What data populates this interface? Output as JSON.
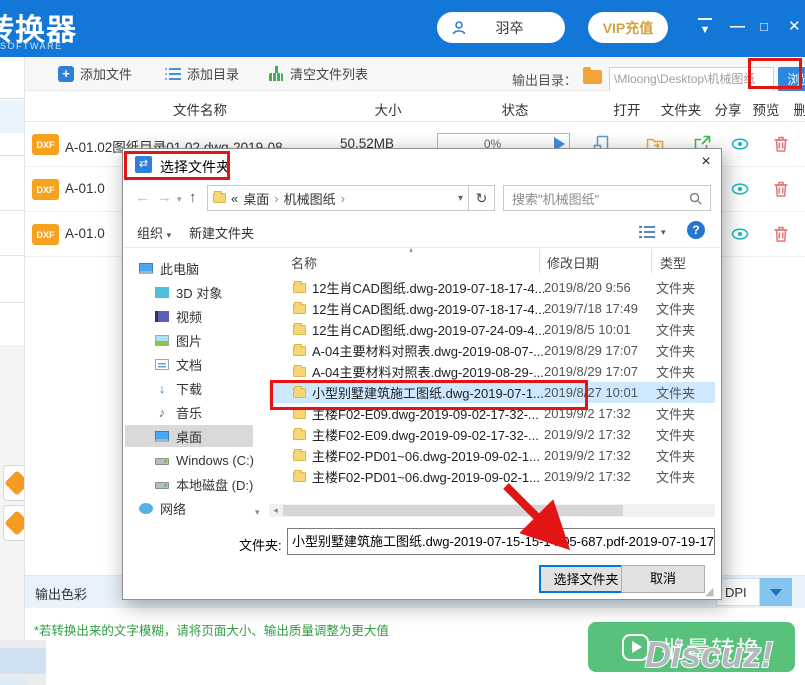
{
  "header": {
    "app_title": "转换器",
    "app_subtitle": "N SOFTWARE",
    "username": "羽卒",
    "vip_label": "VIP充值"
  },
  "toolbar": {
    "add_file": "添加文件",
    "add_folder": "添加目录",
    "clear_list": "清空文件列表",
    "output_dir_label": "输出目录：",
    "output_dir_value": "\\Mloong\\Desktop\\机械图纸",
    "browse": "浏览"
  },
  "table": {
    "cols": {
      "name": "文件名称",
      "size": "大小",
      "status": "状态",
      "open": "打开",
      "folder": "文件夹",
      "share": "分享",
      "preview": "预览",
      "del": "删除"
    },
    "rows": [
      {
        "badge": "DXF",
        "name": "A-01.02图纸目录01.02.dwg-2019-08-",
        "size": "50.52MB",
        "progress": "0%"
      },
      {
        "badge": "DXF",
        "name": "A-01.0"
      },
      {
        "badge": "DXF",
        "name": "A-01.0"
      }
    ]
  },
  "dialog": {
    "title": "选择文件夹",
    "breadcrumb": {
      "collapsed": "«",
      "sep": "›",
      "crumb1": "桌面",
      "crumb2": "机械图纸"
    },
    "search_text": "搜索\"机械图纸\"",
    "menubar": {
      "organize": "组织",
      "new_folder": "新建文件夹"
    },
    "sidebar": [
      {
        "label": "此电脑"
      },
      {
        "label": "3D 对象"
      },
      {
        "label": "视频"
      },
      {
        "label": "图片"
      },
      {
        "label": "文档"
      },
      {
        "label": "下载"
      },
      {
        "label": "音乐"
      },
      {
        "label": "桌面",
        "selected": true
      },
      {
        "label": "Windows (C:)"
      },
      {
        "label": "本地磁盘 (D:)"
      },
      {
        "label": "网络"
      }
    ],
    "list": {
      "col_name": "名称",
      "col_date": "修改日期",
      "col_type": "类型",
      "rows": [
        {
          "name": "12生肖CAD图纸.dwg-2019-07-18-17-4...",
          "date": "2019/8/20 9:56",
          "type": "文件夹"
        },
        {
          "name": "12生肖CAD图纸.dwg-2019-07-18-17-4...",
          "date": "2019/7/18 17:49",
          "type": "文件夹"
        },
        {
          "name": "12生肖CAD图纸.dwg-2019-07-24-09-4...",
          "date": "2019/8/5 10:01",
          "type": "文件夹"
        },
        {
          "name": "A-04主要材料对照表.dwg-2019-08-07-...",
          "date": "2019/8/29 17:07",
          "type": "文件夹"
        },
        {
          "name": "A-04主要材料对照表.dwg-2019-08-29-...",
          "date": "2019/8/29 17:07",
          "type": "文件夹"
        },
        {
          "name": "小型别墅建筑施工图纸.dwg-2019-07-1...",
          "date": "2019/8/27 10:01",
          "type": "文件夹",
          "selected": true
        },
        {
          "name": "主楼F02-E09.dwg-2019-09-02-17-32-...",
          "date": "2019/9/2 17:32",
          "type": "文件夹"
        },
        {
          "name": "主楼F02-E09.dwg-2019-09-02-17-32-...",
          "date": "2019/9/2 17:32",
          "type": "文件夹"
        },
        {
          "name": "主楼F02-PD01~06.dwg-2019-09-02-1...",
          "date": "2019/9/2 17:32",
          "type": "文件夹"
        },
        {
          "name": "主楼F02-PD01~06.dwg-2019-09-02-1...",
          "date": "2019/9/2 17:32",
          "type": "文件夹"
        }
      ]
    },
    "footer": {
      "folder_label": "文件夹:",
      "folder_value": "小型别墅建筑施工图纸.dwg-2019-07-15-15-14-05-687.pdf-2019-07-19-17",
      "select": "选择文件夹",
      "cancel": "取消"
    }
  },
  "bottom": {
    "output_color_label": "输出色彩",
    "dpi_label": "DPI",
    "note": "*若转换出来的文字模糊，请将页面大小、输出质量调整为更大值",
    "convert": "批量转换",
    "watermark": "Discuz!"
  }
}
